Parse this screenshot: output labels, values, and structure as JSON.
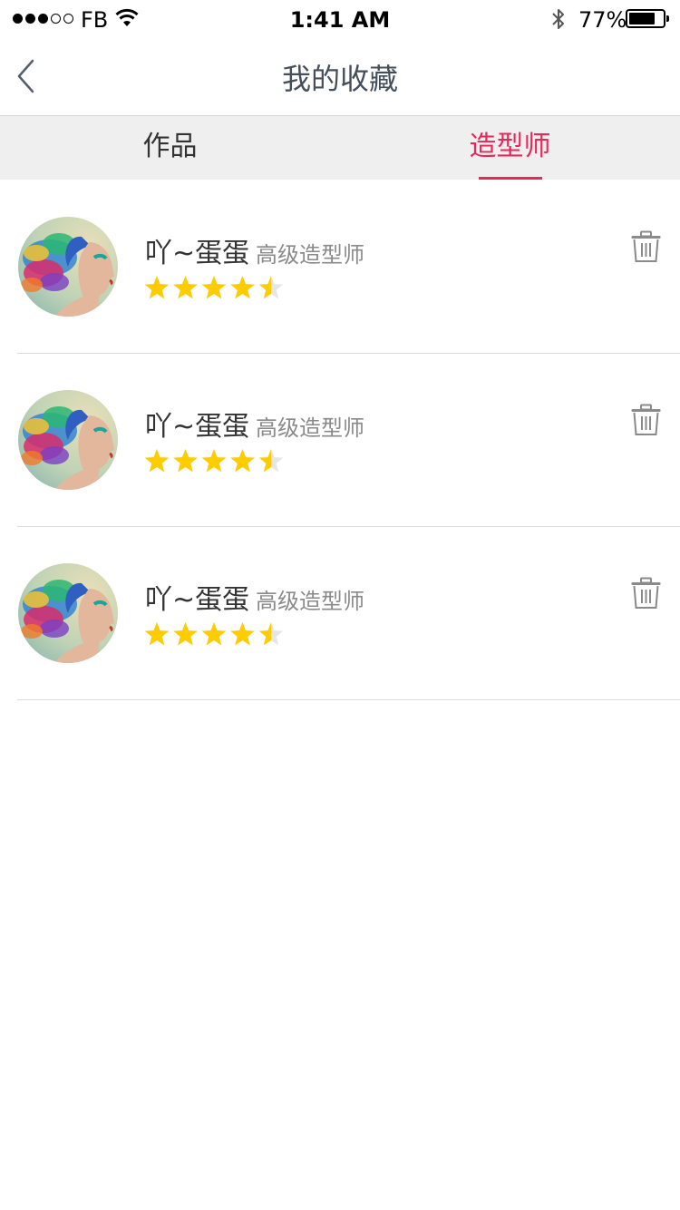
{
  "status_bar": {
    "carrier": "FB",
    "time": "1:41 AM",
    "battery_percent": "77%",
    "battery_level": 0.77,
    "signal_bars_filled": 3,
    "signal_bars_total": 5
  },
  "nav": {
    "back_icon": "chevron-left-icon",
    "title": "我的收藏"
  },
  "tabs": [
    {
      "label": "作品",
      "active": false
    },
    {
      "label": "造型师",
      "active": true
    }
  ],
  "colors": {
    "accent": "#e8285a",
    "star": "#ffcc00",
    "star_empty": "#e6e6e6"
  },
  "stylists": [
    {
      "name": "吖~蛋蛋",
      "title": "高级造型师",
      "rating": 4.5
    },
    {
      "name": "吖~蛋蛋",
      "title": "高级造型师",
      "rating": 4.5
    },
    {
      "name": "吖~蛋蛋",
      "title": "高级造型师",
      "rating": 4.5
    }
  ]
}
